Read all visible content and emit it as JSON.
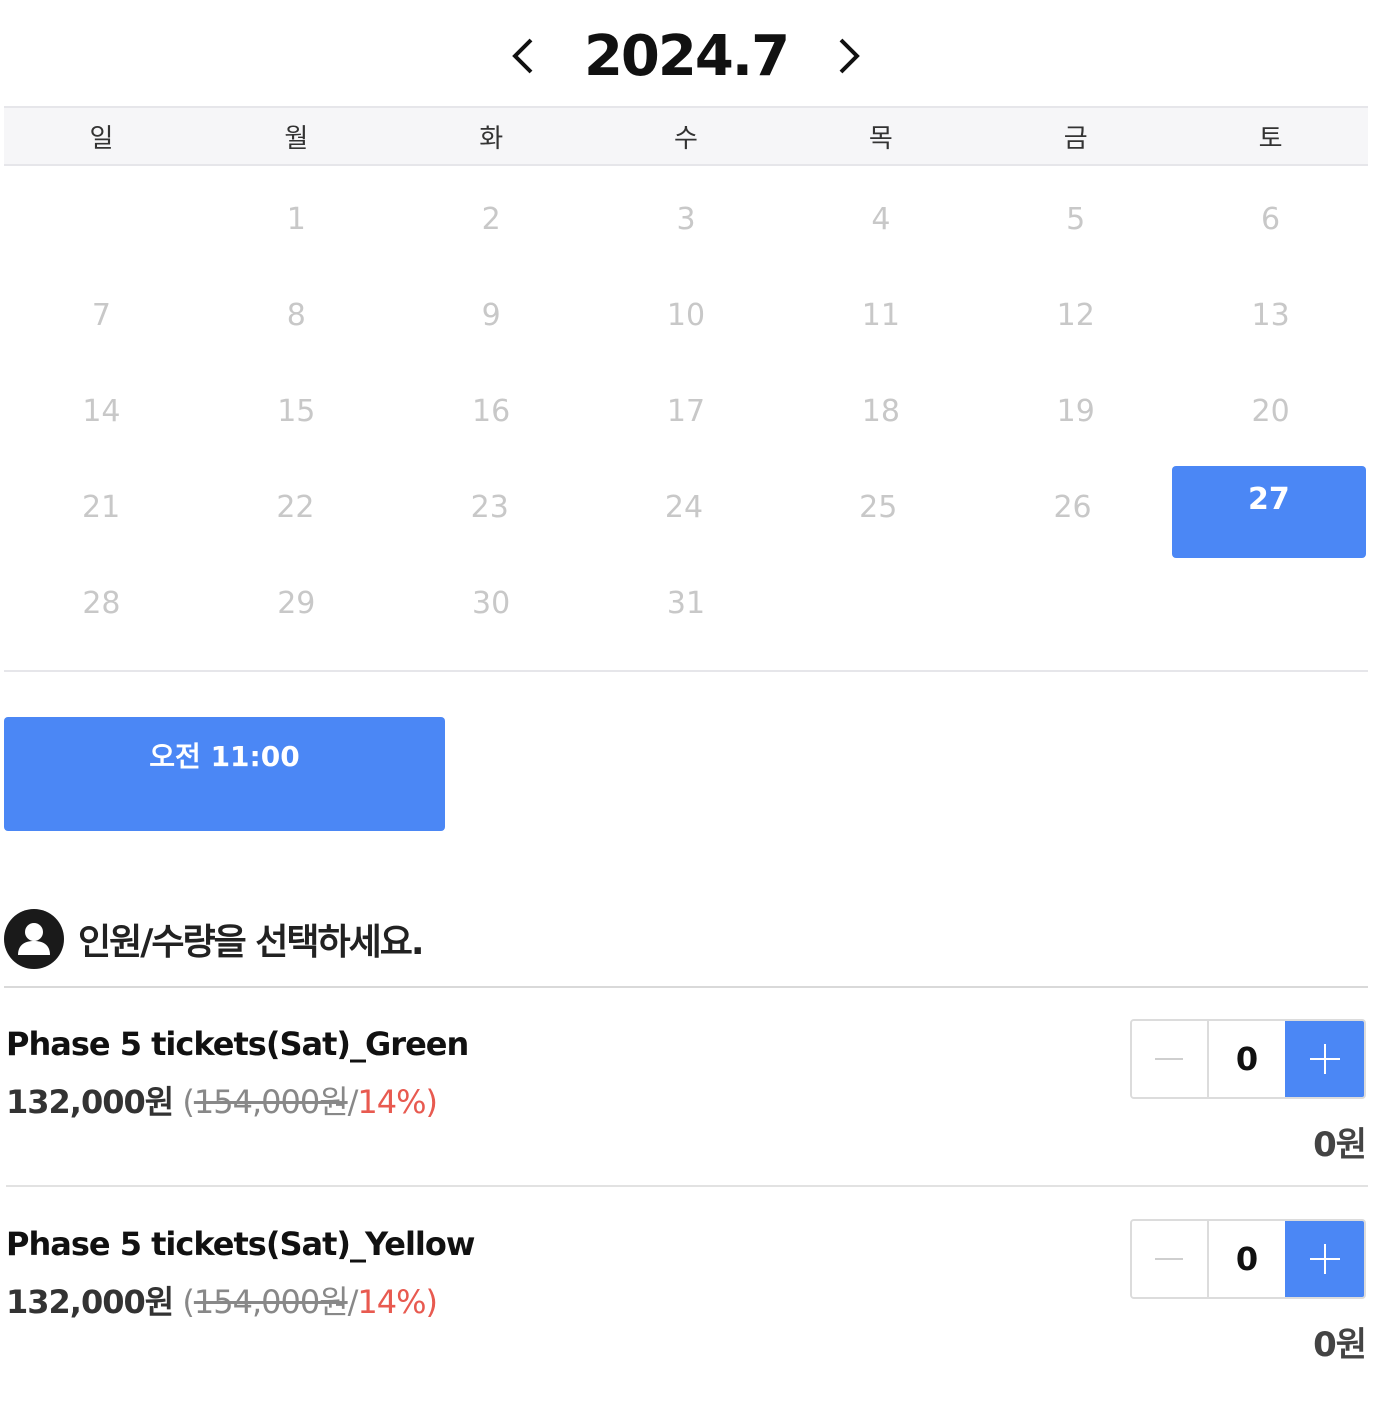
{
  "calendar": {
    "month_label": "2024.7",
    "weekdays": [
      "일",
      "월",
      "화",
      "수",
      "목",
      "금",
      "토"
    ],
    "weeks": [
      [
        "",
        "1",
        "2",
        "3",
        "4",
        "5",
        "6"
      ],
      [
        "7",
        "8",
        "9",
        "10",
        "11",
        "12",
        "13"
      ],
      [
        "14",
        "15",
        "16",
        "17",
        "18",
        "19",
        "20"
      ],
      [
        "21",
        "22",
        "23",
        "24",
        "25",
        "26",
        "27"
      ],
      [
        "28",
        "29",
        "30",
        "31",
        "",
        "",
        ""
      ]
    ],
    "selected_day": "27",
    "accent_color": "#4b87f5"
  },
  "time_slot": {
    "label": "오전 11:00"
  },
  "quantity_section": {
    "title": "인원/수량을 선택하세요."
  },
  "items": [
    {
      "name": "Phase 5 tickets(Sat)_Green",
      "price": "132,000원",
      "original_price": "154,000원",
      "discount": "14%",
      "quantity": "0",
      "total": "0원"
    },
    {
      "name": "Phase 5 tickets(Sat)_Yellow",
      "price": "132,000원",
      "original_price": "154,000원",
      "discount": "14%",
      "quantity": "0",
      "total": "0원"
    }
  ],
  "icons": {
    "prev": "chevron-left-icon",
    "next": "chevron-right-icon",
    "user": "user-icon",
    "minus": "minus-icon",
    "plus": "plus-icon"
  }
}
